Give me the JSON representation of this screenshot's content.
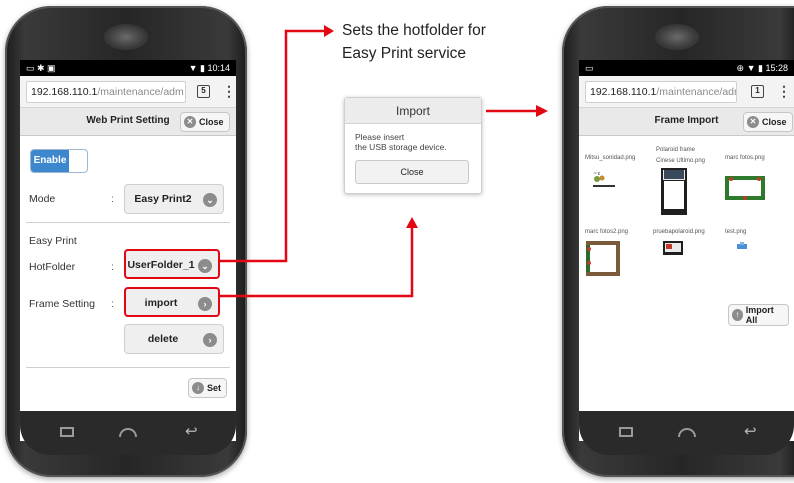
{
  "caption": [
    "Sets the hotfolder for",
    "Easy Print service"
  ],
  "colors": {
    "highlight": "#e30613",
    "enable_blue": "#3d87cf"
  },
  "phone_left": {
    "status": {
      "left_icons": "▭ ✱ ▣",
      "time": "10:14",
      "right_icons": "▼ ▮"
    },
    "url": {
      "host": "192.168.110.1",
      "path": "/maintenance/adm"
    },
    "tab_count": "5",
    "page_title": "Web Print Setting",
    "close_label": "Close",
    "enable_label": "Enable",
    "mode": {
      "label": "Mode",
      "value": "Easy Print2"
    },
    "section_title": "Easy Print",
    "hotfolder": {
      "label": "HotFolder",
      "value": "UserFolder_1"
    },
    "frame_setting": {
      "label": "Frame Setting",
      "import_label": "import",
      "delete_label": "delete"
    },
    "colon": ":",
    "set_label": "Set"
  },
  "popup": {
    "title": "Import",
    "message_line1": "Please insert",
    "message_line2": "the USB storage device.",
    "button": "Close"
  },
  "phone_right": {
    "status": {
      "left_icons": "▭",
      "time": "15:28",
      "right_icons": "⊕ ▼ ▮"
    },
    "url": {
      "host": "192.168.110.1",
      "path": "/maintenance/adm"
    },
    "tab_count": "1",
    "page_title": "Frame Import",
    "close_label": "Close",
    "frames": [
      {
        "name": "Mitsu_sonidad.png"
      },
      {
        "name": "Polaroid frame\nCinese Ultimo.png"
      },
      {
        "name": "marc fotos.png"
      },
      {
        "name": "marc fotos2.png"
      },
      {
        "name": "pruebapolaroid.png"
      },
      {
        "name": "test.png"
      }
    ],
    "import_all_label": "Import All"
  }
}
